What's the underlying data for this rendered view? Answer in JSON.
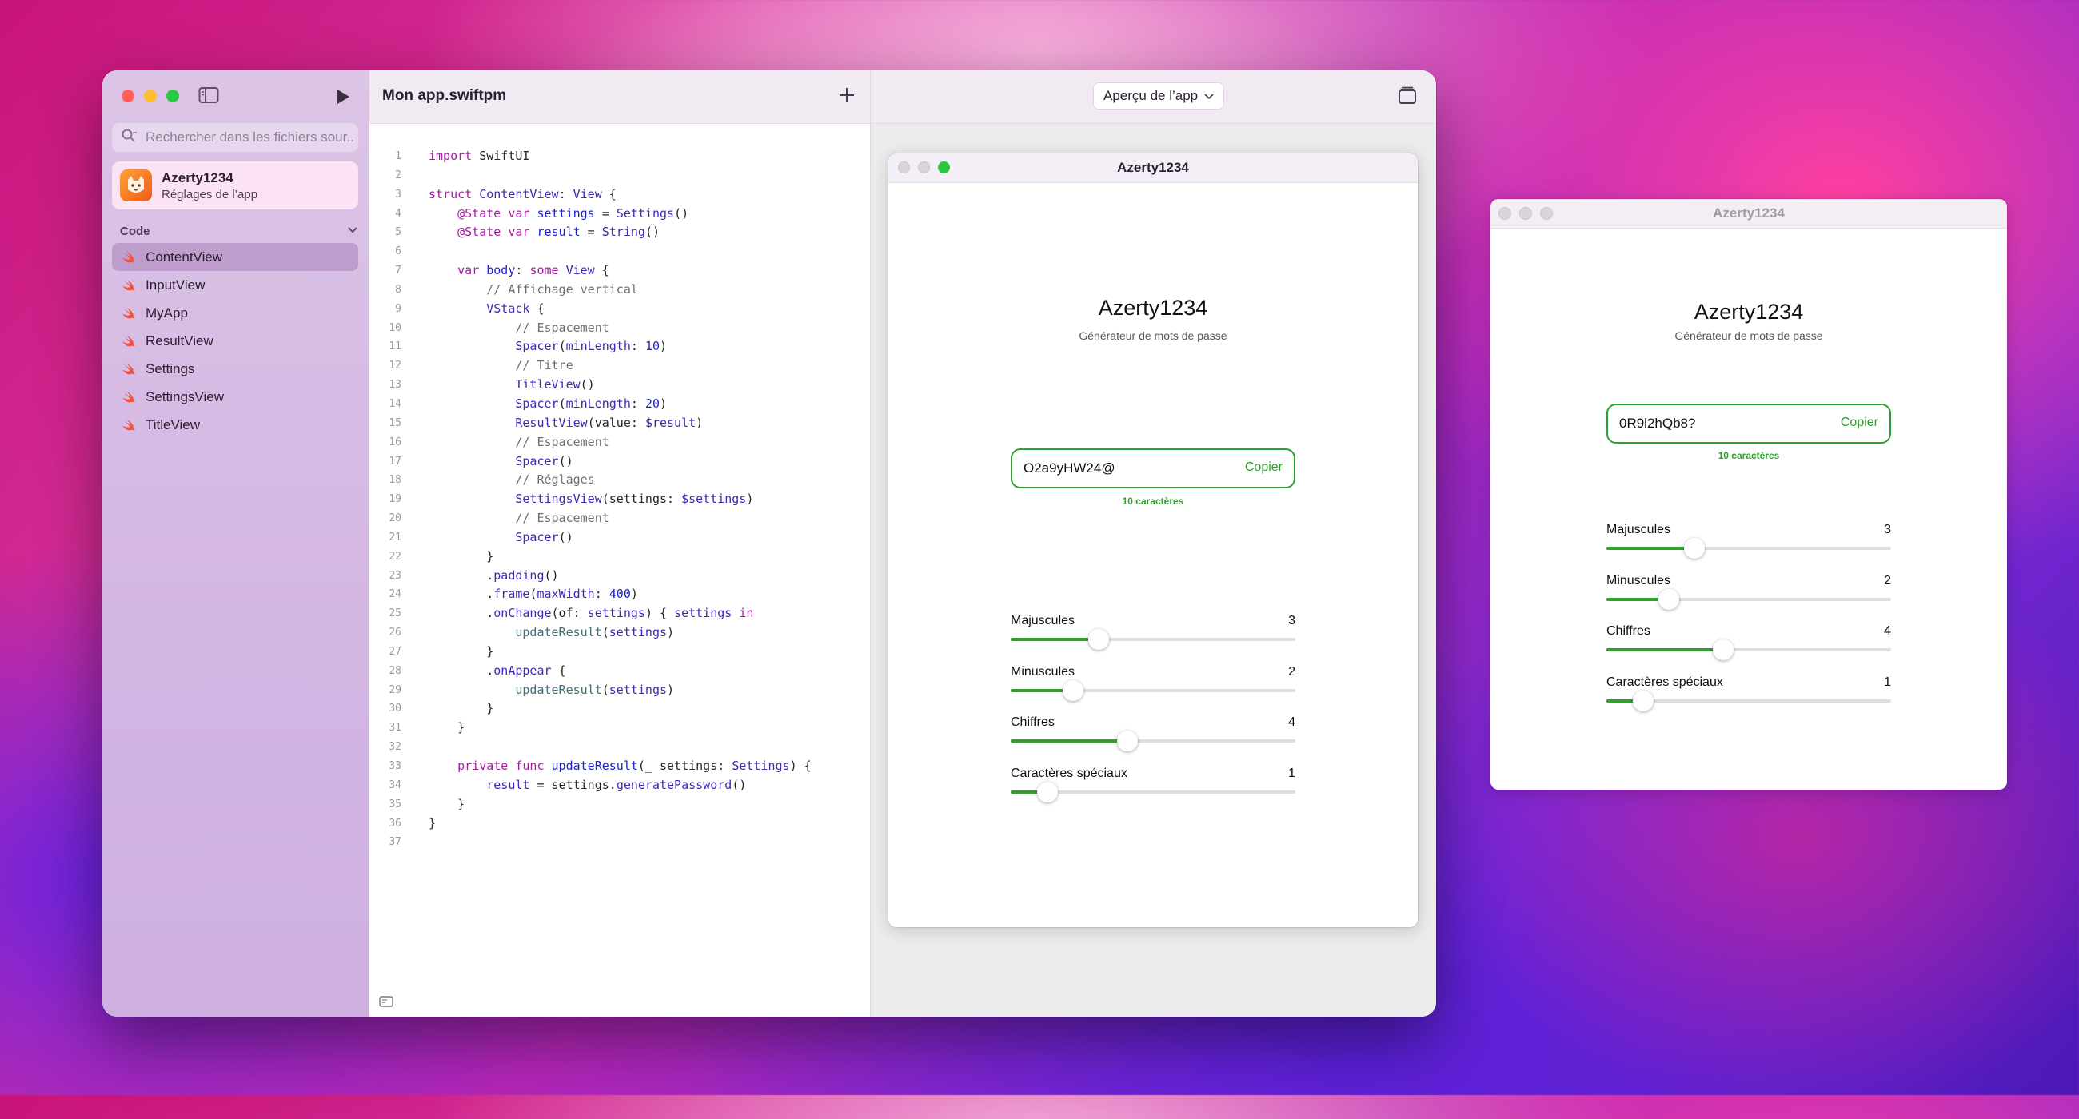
{
  "main_window": {
    "project_title": "Mon app.swiftpm",
    "search_placeholder": "Rechercher dans les fichiers sour...",
    "app_card": {
      "name": "Azerty1234",
      "subtitle": "Réglages de l’app"
    },
    "section_title": "Code",
    "files": [
      {
        "label": "ContentView",
        "selected": true
      },
      {
        "label": "InputView"
      },
      {
        "label": "MyApp"
      },
      {
        "label": "ResultView"
      },
      {
        "label": "Settings"
      },
      {
        "label": "SettingsView"
      },
      {
        "label": "TitleView"
      }
    ],
    "preview_menu_label": "Aperçu de l’app"
  },
  "code_lines": [
    "<span class='k'>import</span> SwiftUI",
    "",
    "<span class='k'>struct</span> <span class='t'>ContentView</span>: <span class='t'>View</span> {",
    "    <span class='k'>@State</span> <span class='k'>var</span> <span class='n'>settings</span> = <span class='t'>Settings</span>()",
    "    <span class='k'>@State</span> <span class='k'>var</span> <span class='n'>result</span> = <span class='t'>String</span>()",
    "",
    "    <span class='k'>var</span> <span class='n'>body</span>: <span class='k'>some</span> <span class='t'>View</span> {",
    "        <span class='c'>// Affichage vertical</span>",
    "        <span class='t'>VStack</span> {",
    "            <span class='c'>// Espacement</span>",
    "            <span class='t'>Spacer</span>(<span class='t'>minLength</span>: <span class='n'>10</span>)",
    "            <span class='c'>// Titre</span>",
    "            <span class='t'>TitleView</span>()",
    "            <span class='t'>Spacer</span>(<span class='t'>minLength</span>: <span class='n'>20</span>)",
    "            <span class='t'>ResultView</span>(value: <span class='t'>$result</span>)",
    "            <span class='c'>// Espacement</span>",
    "            <span class='t'>Spacer</span>()",
    "            <span class='c'>// Réglages</span>",
    "            <span class='t'>SettingsView</span>(settings: <span class='t'>$settings</span>)",
    "            <span class='c'>// Espacement</span>",
    "            <span class='t'>Spacer</span>()",
    "        }",
    "        .<span class='t'>padding</span>()",
    "        .<span class='t'>frame</span>(<span class='t'>maxWidth</span>: <span class='n'>400</span>)",
    "        .<span class='t'>onChange</span>(of: <span class='t'>settings</span>) { <span class='t'>settings</span> <span class='k'>in</span>",
    "            <span class='f'>updateResult</span>(<span class='t'>settings</span>)",
    "        }",
    "        .<span class='t'>onAppear</span> {",
    "            <span class='f'>updateResult</span>(<span class='t'>settings</span>)",
    "        }",
    "    }",
    "",
    "    <span class='k'>private</span> <span class='k'>func</span> <span class='n'>updateResult</span>(_ settings: <span class='t'>Settings</span>) {",
    "        <span class='t'>result</span> = settings.<span class='t'>generatePassword</span>()",
    "    }",
    "}",
    ""
  ],
  "preview_app": {
    "window_title": "Azerty1234",
    "title": "Azerty1234",
    "subtitle": "Générateur de mots de passe",
    "password": "O2a9yHW24@",
    "copy_label": "Copier",
    "count_label": "10 caractères",
    "sliders": [
      {
        "label": "Majuscules",
        "value": "3",
        "fraction": 0.31
      },
      {
        "label": "Minuscules",
        "value": "2",
        "fraction": 0.22
      },
      {
        "label": "Chiffres",
        "value": "4",
        "fraction": 0.41
      },
      {
        "label": "Caractères spéciaux",
        "value": "1",
        "fraction": 0.13
      }
    ]
  },
  "standalone_app": {
    "window_title": "Azerty1234",
    "title": "Azerty1234",
    "subtitle": "Générateur de mots de passe",
    "password": "0R9l2hQb8?",
    "copy_label": "Copier",
    "count_label": "10 caractères",
    "sliders": [
      {
        "label": "Majuscules",
        "value": "3",
        "fraction": 0.31
      },
      {
        "label": "Minuscules",
        "value": "2",
        "fraction": 0.22
      },
      {
        "label": "Chiffres",
        "value": "4",
        "fraction": 0.41
      },
      {
        "label": "Caractères spéciaux",
        "value": "1",
        "fraction": 0.13
      }
    ]
  },
  "colors": {
    "accent_green": "#2ea02e",
    "sidebar": "#d2b6e2"
  },
  "icons": [
    "sidebar-toggle-icon",
    "play-icon",
    "search-icon",
    "chevron-down-icon",
    "swift-icon",
    "plus-icon",
    "sheet-icon",
    "terminal-icon",
    "app-cat-icon"
  ]
}
